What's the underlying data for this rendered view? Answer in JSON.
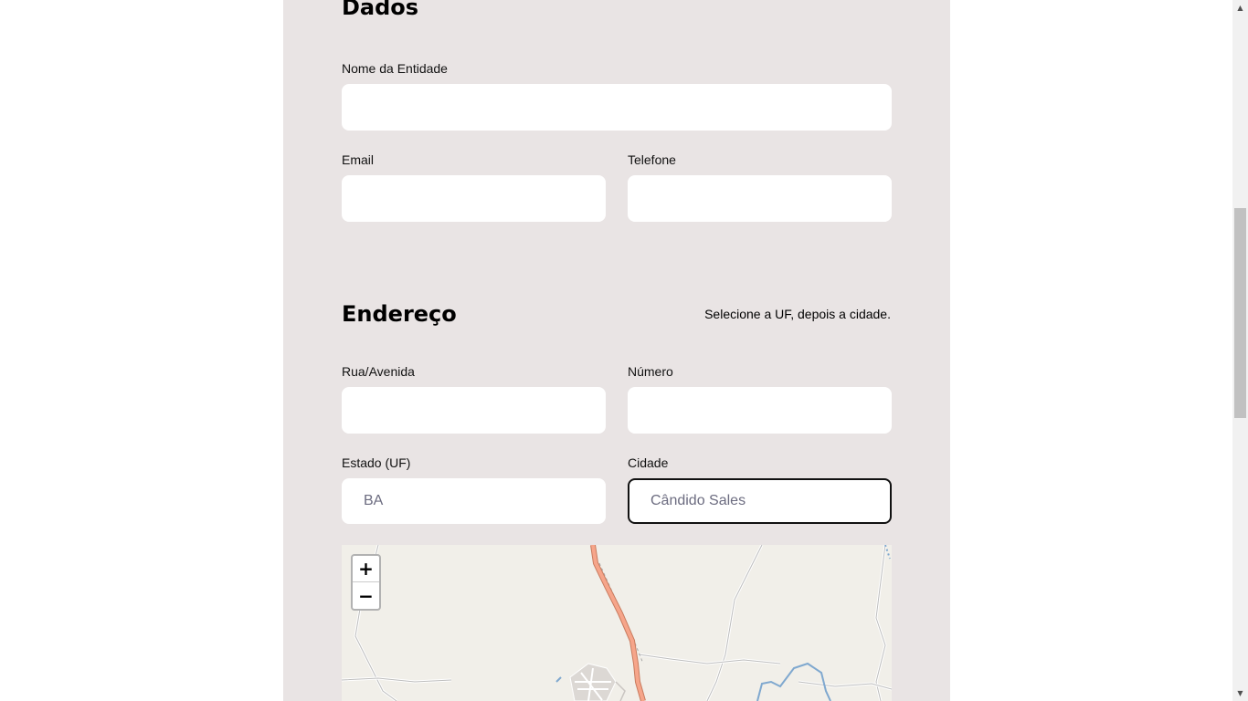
{
  "sections": {
    "dados_title": "Dados",
    "endereco_title": "Endereço",
    "endereco_hint": "Selecione a UF, depois a cidade."
  },
  "fields": {
    "nome_label": "Nome da Entidade",
    "email_label": "Email",
    "telefone_label": "Telefone",
    "rua_label": "Rua/Avenida",
    "numero_label": "Número",
    "estado_label": "Estado (UF)",
    "estado_value": "BA",
    "cidade_label": "Cidade",
    "cidade_value": "Cândido Sales"
  },
  "map": {
    "zoom_in": "+",
    "zoom_out": "−"
  },
  "icons": {
    "scroll_up": "arrow-up-icon",
    "scroll_down": "arrow-down-icon"
  }
}
